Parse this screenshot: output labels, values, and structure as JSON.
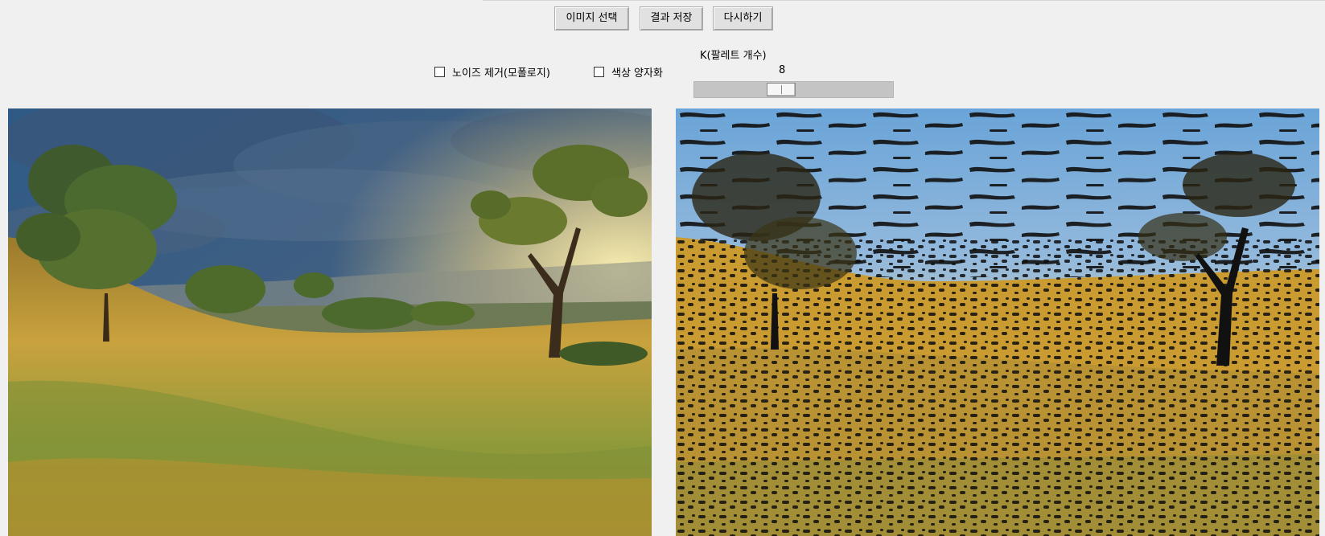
{
  "toolbar": {
    "select_image_label": "이미지 선택",
    "save_result_label": "결과 저장",
    "reset_label": "다시하기"
  },
  "options": {
    "denoise_label": "노이즈 제거(모폴로지)",
    "denoise_checked": false,
    "quantize_label": "색상 양자화",
    "quantize_checked": false
  },
  "palette_slider": {
    "label": "K(팔레트 개수)",
    "value": "8"
  },
  "panels": {
    "original_icon": "landscape-photo",
    "result_icon": "quantized-landscape-photo"
  }
}
